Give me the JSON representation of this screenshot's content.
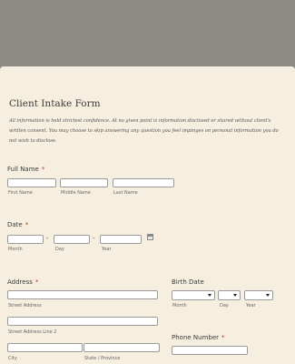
{
  "form": {
    "title": "Client Intake Form",
    "intro": "All information is held strictest confidence. At no given point is information disclosed or shared without client's written consent. You may choose to skip answering any question you feel impinges on personal information you do not wish to disclose."
  },
  "full_name": {
    "label": "Full Name",
    "required_mark": "*",
    "first_sublabel": "First Name",
    "middle_sublabel": "Middle Name",
    "last_sublabel": "Last Name",
    "first_value": "",
    "middle_value": "",
    "last_value": ""
  },
  "date": {
    "label": "Date",
    "required_mark": "*",
    "separator": "-",
    "month_sublabel": "Month",
    "day_sublabel": "Day",
    "year_sublabel": "Year",
    "icon": "calendar-icon"
  },
  "address": {
    "label": "Address",
    "required_mark": "*",
    "street_sublabel": "Street Address",
    "street2_sublabel": "Street Address Line 2",
    "city_sublabel": "City",
    "state_sublabel": "State / Province"
  },
  "birth_date": {
    "label": "Birth Date",
    "month_sublabel": "Month",
    "day_sublabel": "Day",
    "year_sublabel": "Year",
    "month_value": "",
    "day_value": "",
    "year_value": ""
  },
  "phone": {
    "label": "Phone Number",
    "required_mark": "*"
  },
  "colors": {
    "background": "#8e8b85",
    "form_background": "#f6efe0",
    "required": "#c0392b"
  }
}
